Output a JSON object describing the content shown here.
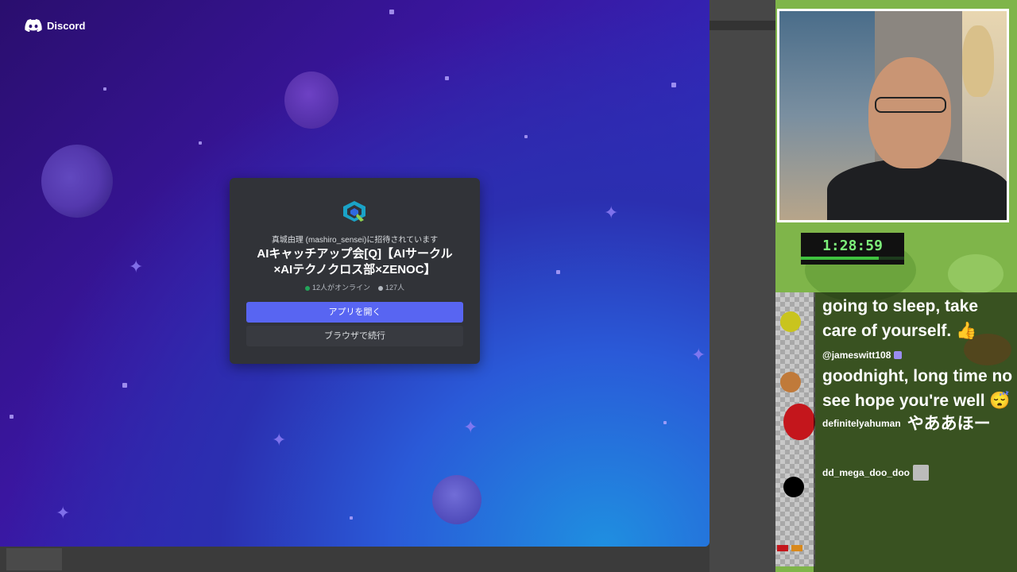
{
  "discord": {
    "brand": "Discord",
    "invite": {
      "inviter_text": "真城由理 (mashiro_sensei)に招待されています",
      "server_name_line1": "AIキャッチアップ会[Q]【AIサークル",
      "server_name_line2": "×AIテクノクロス部×ZENOC】",
      "online_text": "12人がオンライン",
      "members_text": "127人",
      "open_app_label": "アプリを開く",
      "continue_browser_label": "ブラウザで続行"
    },
    "colors": {
      "blurple": "#5865f2",
      "online": "#23a55a",
      "card": "#313338"
    }
  },
  "stream": {
    "timer": "1:28:59",
    "chat": [
      {
        "text": "going to sleep, take care of yourself. 👍"
      },
      {
        "user": "@jameswitt108",
        "text": "goodnight, long time no see hope you're well 😴"
      },
      {
        "user": "definitelyahuman",
        "text": "やああほー"
      },
      {
        "user": "dd_mega_doo_doo",
        "text": ""
      }
    ]
  }
}
